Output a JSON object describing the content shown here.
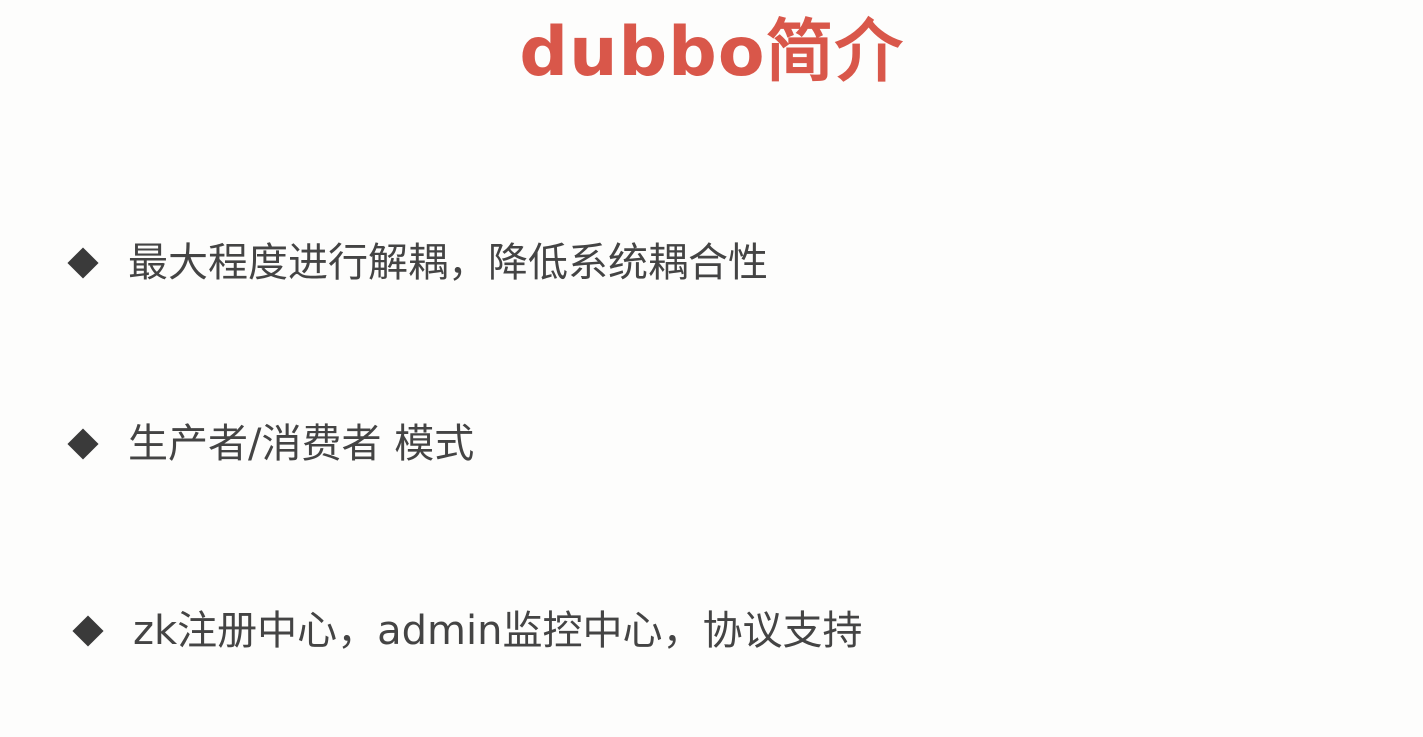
{
  "slide": {
    "title": "dubbo简介",
    "title_color": "#d9574a",
    "text_color": "#444444",
    "bullet_icon": "diamond-bullet",
    "bullet_color": "#3a3a3a",
    "bullets": [
      {
        "text": "最大程度进行解耦，降低系统耦合性"
      },
      {
        "text": "生产者/消费者 模式"
      },
      {
        "text": "zk注册中心，admin监控中心，协议支持"
      }
    ]
  }
}
